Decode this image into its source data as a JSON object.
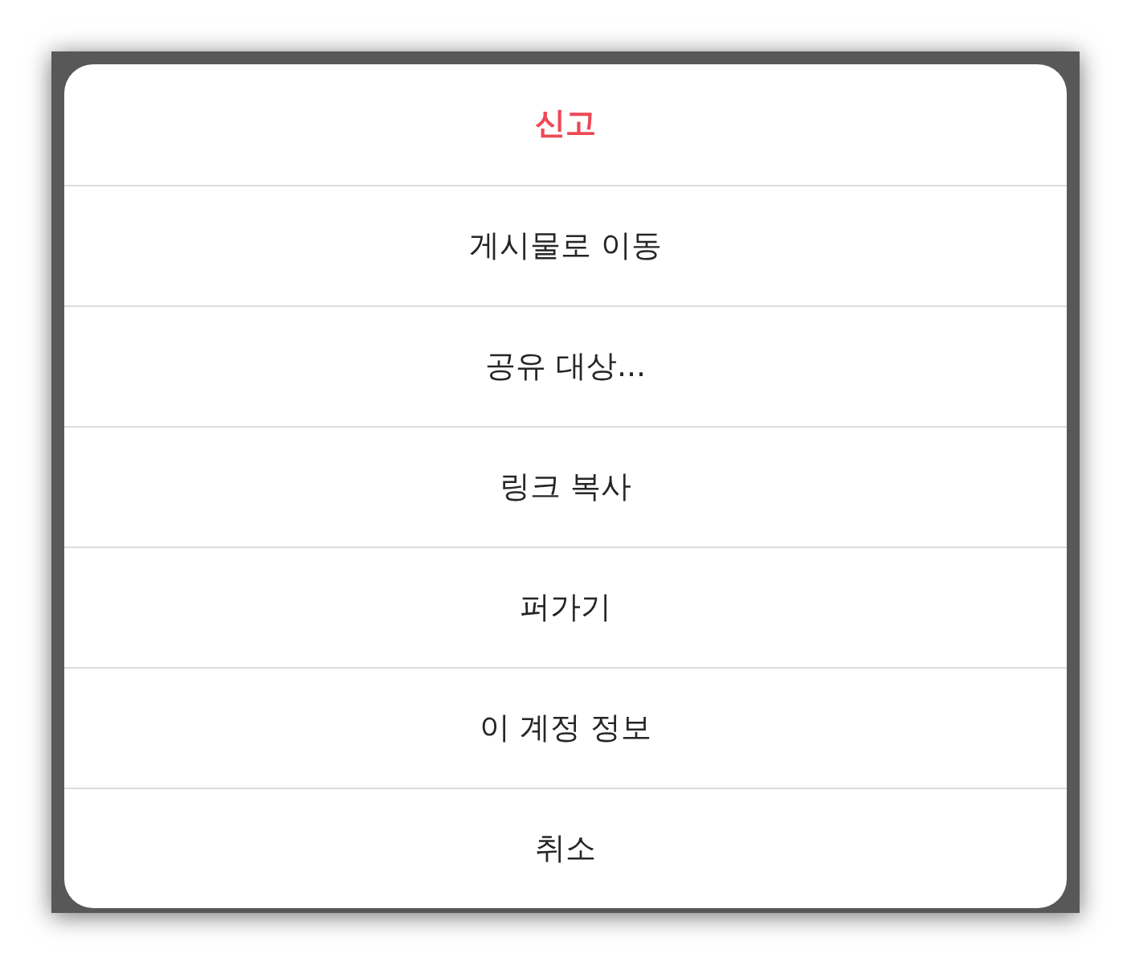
{
  "dialog": {
    "items": [
      {
        "label": "신고",
        "kind": "danger"
      },
      {
        "label": "게시물로 이동",
        "kind": "normal"
      },
      {
        "label": "공유 대상...",
        "kind": "normal"
      },
      {
        "label": "링크 복사",
        "kind": "normal"
      },
      {
        "label": "퍼가기",
        "kind": "normal"
      },
      {
        "label": "이 계정 정보",
        "kind": "normal"
      },
      {
        "label": "취소",
        "kind": "normal"
      }
    ]
  }
}
